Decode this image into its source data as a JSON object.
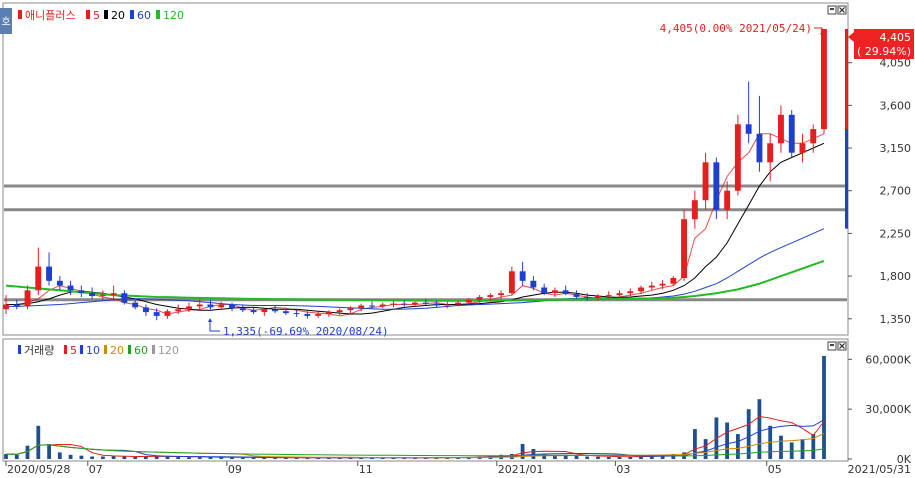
{
  "colors": {
    "up": "#e41f1f",
    "down": "#1f3fcf",
    "ma5": "#000000",
    "ma20": "#000000",
    "ma60": "#1f3fcf",
    "ma120": "#22bb22",
    "hline": "#888888",
    "vol_ma5": "#e41f1f",
    "vol_ma10": "#1f3fcf",
    "vol_ma20": "#d08a00",
    "vol_ma60": "#22a022",
    "vol_ma120": "#999999",
    "current_price_bg": "#ee2222"
  },
  "side_icon_label": "호",
  "window_icons": [
    "restore-icon",
    "close-icon"
  ],
  "price_panel": {
    "legend": {
      "name": "애니플러스",
      "items": [
        {
          "label": "5",
          "color": "#e41f1f"
        },
        {
          "label": "20",
          "color": "#000000"
        },
        {
          "label": "60",
          "color": "#1f3fcf"
        },
        {
          "label": "120",
          "color": "#22bb22"
        }
      ]
    },
    "high_note": "4,405(0.00% 2021/05/24)",
    "low_note": "1,335(-69.69% 2020/08/24)",
    "current_price": "4,405",
    "current_change": "( 29.94%)",
    "y_ticks": [
      "4,050",
      "3,600",
      "3,150",
      "2,700",
      "2,250",
      "1,800",
      "1,350"
    ]
  },
  "volume_panel": {
    "legend": {
      "name": "거래량",
      "items": [
        {
          "label": "5",
          "color": "#e41f1f"
        },
        {
          "label": "10",
          "color": "#1f3fcf"
        },
        {
          "label": "20",
          "color": "#d08a00"
        },
        {
          "label": "60",
          "color": "#22a022"
        },
        {
          "label": "120",
          "color": "#999999"
        }
      ]
    },
    "y_ticks": [
      "60,000K",
      "30,000K",
      "0K"
    ]
  },
  "x_axis": {
    "ticks": [
      "2020/05/28",
      "07",
      "09",
      "11",
      "2021/01",
      "03",
      "05"
    ],
    "end_label": "2021/05/31"
  },
  "chart_data": [
    {
      "type": "candlestick",
      "title": "애니플러스",
      "x_start": "2020/05/28",
      "x_end": "2021/05/31",
      "x_ticks": [
        "2020/05/28",
        "07",
        "09",
        "11",
        "2021/01",
        "03",
        "05"
      ],
      "ylim": [
        1200,
        4500
      ],
      "y_ticks": [
        4050,
        3600,
        3150,
        2700,
        2250,
        1800,
        1350
      ],
      "horizontal_lines": [
        2750,
        2500,
        1550
      ],
      "annotations": [
        {
          "text": "4,405(0.00% 2021/05/24)",
          "value": 4405,
          "date": "2021/05/24"
        },
        {
          "text": "1,335(-69.69% 2020/08/24)",
          "value": 1335,
          "date": "2020/08/24"
        }
      ],
      "current": {
        "price": 4405,
        "change_pct": 29.94
      },
      "series": [
        {
          "name": "5",
          "values": [
            1500,
            1500,
            1520,
            1560,
            1650,
            1700,
            1670,
            1640,
            1610,
            1580,
            1560,
            1520,
            1500,
            1460,
            1440,
            1400,
            1420,
            1440,
            1450,
            1480,
            1500,
            1500,
            1460,
            1440,
            1450,
            1470,
            1460,
            1440,
            1420,
            1410,
            1400,
            1380,
            1400,
            1450,
            1470,
            1480,
            1500,
            1500,
            1500,
            1510,
            1520,
            1500,
            1500,
            1510,
            1530,
            1550,
            1580,
            1600,
            1700,
            1670,
            1620,
            1600,
            1620,
            1600,
            1580,
            1560,
            1560,
            1580,
            1600,
            1620,
            1650,
            1680,
            1700,
            1800,
            2200,
            2300,
            2600,
            2850,
            3000,
            3100,
            3300,
            3300,
            3250,
            3200,
            3200,
            3250,
            3300
          ]
        },
        {
          "name": "20",
          "values": [
            1500,
            1500,
            1510,
            1530,
            1560,
            1600,
            1630,
            1640,
            1630,
            1620,
            1600,
            1580,
            1560,
            1530,
            1500,
            1480,
            1460,
            1450,
            1440,
            1440,
            1450,
            1460,
            1470,
            1470,
            1460,
            1450,
            1450,
            1450,
            1440,
            1430,
            1420,
            1410,
            1400,
            1400,
            1410,
            1430,
            1450,
            1470,
            1480,
            1490,
            1500,
            1500,
            1500,
            1505,
            1510,
            1520,
            1530,
            1550,
            1580,
            1600,
            1620,
            1630,
            1630,
            1620,
            1600,
            1590,
            1580,
            1575,
            1580,
            1590,
            1600,
            1620,
            1650,
            1700,
            1780,
            1900,
            2000,
            2150,
            2350,
            2550,
            2750,
            2900,
            3000,
            3050,
            3100,
            3150,
            3200
          ]
        },
        {
          "name": "60",
          "values": [
            1480,
            1480,
            1485,
            1490,
            1495,
            1500,
            1510,
            1520,
            1530,
            1540,
            1550,
            1555,
            1560,
            1560,
            1555,
            1550,
            1545,
            1540,
            1530,
            1520,
            1510,
            1500,
            1495,
            1490,
            1490,
            1490,
            1490,
            1488,
            1485,
            1480,
            1475,
            1470,
            1465,
            1460,
            1455,
            1450,
            1450,
            1452,
            1455,
            1460,
            1470,
            1480,
            1490,
            1495,
            1500,
            1505,
            1510,
            1515,
            1520,
            1530,
            1540,
            1550,
            1560,
            1565,
            1570,
            1570,
            1568,
            1566,
            1566,
            1568,
            1570,
            1580,
            1590,
            1610,
            1640,
            1680,
            1720,
            1780,
            1850,
            1920,
            1990,
            2050,
            2100,
            2150,
            2200,
            2250,
            2300
          ]
        },
        {
          "name": "120",
          "values": [
            1700,
            1690,
            1680,
            1670,
            1660,
            1650,
            1640,
            1630,
            1620,
            1610,
            1600,
            1595,
            1590,
            1585,
            1580,
            1578,
            1575,
            1572,
            1570,
            1568,
            1566,
            1564,
            1562,
            1560,
            1558,
            1556,
            1555,
            1554,
            1553,
            1552,
            1551,
            1550,
            1549,
            1548,
            1547,
            1546,
            1545,
            1544,
            1543,
            1542,
            1541,
            1540,
            1540,
            1540,
            1540,
            1541,
            1542,
            1543,
            1545,
            1547,
            1549,
            1551,
            1553,
            1555,
            1556,
            1557,
            1558,
            1559,
            1560,
            1562,
            1565,
            1568,
            1572,
            1580,
            1590,
            1605,
            1620,
            1640,
            1660,
            1690,
            1720,
            1760,
            1800,
            1840,
            1880,
            1920,
            1960
          ]
        }
      ],
      "candles": [
        {
          "o": 1450,
          "h": 1600,
          "l": 1400,
          "c": 1500
        },
        {
          "o": 1500,
          "h": 1550,
          "l": 1450,
          "c": 1480
        },
        {
          "o": 1480,
          "h": 1700,
          "l": 1450,
          "c": 1650
        },
        {
          "o": 1650,
          "h": 2100,
          "l": 1600,
          "c": 1900
        },
        {
          "o": 1900,
          "h": 2050,
          "l": 1700,
          "c": 1750
        },
        {
          "o": 1750,
          "h": 1800,
          "l": 1650,
          "c": 1700
        },
        {
          "o": 1700,
          "h": 1750,
          "l": 1600,
          "c": 1650
        },
        {
          "o": 1650,
          "h": 1700,
          "l": 1580,
          "c": 1620
        },
        {
          "o": 1620,
          "h": 1680,
          "l": 1560,
          "c": 1590
        },
        {
          "o": 1590,
          "h": 1650,
          "l": 1550,
          "c": 1600
        },
        {
          "o": 1600,
          "h": 1700,
          "l": 1550,
          "c": 1620
        },
        {
          "o": 1620,
          "h": 1650,
          "l": 1500,
          "c": 1520
        },
        {
          "o": 1520,
          "h": 1560,
          "l": 1450,
          "c": 1470
        },
        {
          "o": 1470,
          "h": 1500,
          "l": 1380,
          "c": 1420
        },
        {
          "o": 1420,
          "h": 1460,
          "l": 1335,
          "c": 1380
        },
        {
          "o": 1380,
          "h": 1450,
          "l": 1350,
          "c": 1430
        },
        {
          "o": 1430,
          "h": 1500,
          "l": 1400,
          "c": 1450
        },
        {
          "o": 1450,
          "h": 1520,
          "l": 1420,
          "c": 1480
        },
        {
          "o": 1480,
          "h": 1560,
          "l": 1440,
          "c": 1500
        },
        {
          "o": 1500,
          "h": 1550,
          "l": 1450,
          "c": 1470
        },
        {
          "o": 1470,
          "h": 1530,
          "l": 1440,
          "c": 1500
        },
        {
          "o": 1500,
          "h": 1520,
          "l": 1430,
          "c": 1460
        },
        {
          "o": 1460,
          "h": 1500,
          "l": 1420,
          "c": 1440
        },
        {
          "o": 1440,
          "h": 1470,
          "l": 1400,
          "c": 1420
        },
        {
          "o": 1420,
          "h": 1460,
          "l": 1380,
          "c": 1450
        },
        {
          "o": 1450,
          "h": 1490,
          "l": 1410,
          "c": 1430
        },
        {
          "o": 1430,
          "h": 1460,
          "l": 1390,
          "c": 1410
        },
        {
          "o": 1410,
          "h": 1450,
          "l": 1370,
          "c": 1400
        },
        {
          "o": 1400,
          "h": 1430,
          "l": 1350,
          "c": 1380
        },
        {
          "o": 1380,
          "h": 1420,
          "l": 1360,
          "c": 1400
        },
        {
          "o": 1400,
          "h": 1440,
          "l": 1370,
          "c": 1420
        },
        {
          "o": 1420,
          "h": 1460,
          "l": 1390,
          "c": 1440
        },
        {
          "o": 1440,
          "h": 1480,
          "l": 1410,
          "c": 1460
        },
        {
          "o": 1460,
          "h": 1510,
          "l": 1430,
          "c": 1490
        },
        {
          "o": 1490,
          "h": 1530,
          "l": 1450,
          "c": 1480
        },
        {
          "o": 1480,
          "h": 1520,
          "l": 1460,
          "c": 1500
        },
        {
          "o": 1500,
          "h": 1540,
          "l": 1470,
          "c": 1510
        },
        {
          "o": 1510,
          "h": 1550,
          "l": 1480,
          "c": 1500
        },
        {
          "o": 1500,
          "h": 1530,
          "l": 1470,
          "c": 1520
        },
        {
          "o": 1520,
          "h": 1560,
          "l": 1490,
          "c": 1510
        },
        {
          "o": 1510,
          "h": 1540,
          "l": 1470,
          "c": 1490
        },
        {
          "o": 1490,
          "h": 1530,
          "l": 1460,
          "c": 1500
        },
        {
          "o": 1500,
          "h": 1540,
          "l": 1480,
          "c": 1520
        },
        {
          "o": 1520,
          "h": 1570,
          "l": 1500,
          "c": 1550
        },
        {
          "o": 1550,
          "h": 1600,
          "l": 1520,
          "c": 1580
        },
        {
          "o": 1580,
          "h": 1620,
          "l": 1540,
          "c": 1600
        },
        {
          "o": 1600,
          "h": 1650,
          "l": 1560,
          "c": 1620
        },
        {
          "o": 1620,
          "h": 1900,
          "l": 1600,
          "c": 1850
        },
        {
          "o": 1850,
          "h": 1950,
          "l": 1700,
          "c": 1750
        },
        {
          "o": 1750,
          "h": 1800,
          "l": 1650,
          "c": 1680
        },
        {
          "o": 1680,
          "h": 1720,
          "l": 1600,
          "c": 1620
        },
        {
          "o": 1620,
          "h": 1680,
          "l": 1580,
          "c": 1650
        },
        {
          "o": 1650,
          "h": 1700,
          "l": 1600,
          "c": 1610
        },
        {
          "o": 1610,
          "h": 1650,
          "l": 1560,
          "c": 1580
        },
        {
          "o": 1580,
          "h": 1620,
          "l": 1540,
          "c": 1570
        },
        {
          "o": 1570,
          "h": 1610,
          "l": 1540,
          "c": 1590
        },
        {
          "o": 1590,
          "h": 1640,
          "l": 1560,
          "c": 1600
        },
        {
          "o": 1600,
          "h": 1650,
          "l": 1570,
          "c": 1620
        },
        {
          "o": 1620,
          "h": 1670,
          "l": 1590,
          "c": 1640
        },
        {
          "o": 1640,
          "h": 1700,
          "l": 1610,
          "c": 1680
        },
        {
          "o": 1680,
          "h": 1740,
          "l": 1650,
          "c": 1700
        },
        {
          "o": 1700,
          "h": 1760,
          "l": 1660,
          "c": 1720
        },
        {
          "o": 1720,
          "h": 1800,
          "l": 1700,
          "c": 1780
        },
        {
          "o": 1780,
          "h": 2500,
          "l": 1750,
          "c": 2400
        },
        {
          "o": 2400,
          "h": 2700,
          "l": 2300,
          "c": 2600
        },
        {
          "o": 2600,
          "h": 3100,
          "l": 2500,
          "c": 3000
        },
        {
          "o": 3000,
          "h": 3050,
          "l": 2400,
          "c": 2500
        },
        {
          "o": 2500,
          "h": 2800,
          "l": 2400,
          "c": 2700
        },
        {
          "o": 2700,
          "h": 3500,
          "l": 2650,
          "c": 3400
        },
        {
          "o": 3400,
          "h": 3850,
          "l": 3200,
          "c": 3300
        },
        {
          "o": 3300,
          "h": 3700,
          "l": 2900,
          "c": 3000
        },
        {
          "o": 3000,
          "h": 3300,
          "l": 2800,
          "c": 3200
        },
        {
          "o": 3200,
          "h": 3600,
          "l": 3100,
          "c": 3500
        },
        {
          "o": 3500,
          "h": 3550,
          "l": 3050,
          "c": 3100
        },
        {
          "o": 3100,
          "h": 3300,
          "l": 3000,
          "c": 3200
        },
        {
          "o": 3200,
          "h": 3400,
          "l": 3100,
          "c": 3350
        },
        {
          "o": 3350,
          "h": 4405,
          "l": 3300,
          "c": 4405
        }
      ]
    },
    {
      "type": "bar",
      "title": "거래량",
      "ylim": [
        0,
        62000
      ],
      "y_ticks": [
        60000,
        30000,
        0
      ],
      "values": [
        3000,
        2500,
        8000,
        20000,
        9000,
        4000,
        2500,
        2000,
        1500,
        1500,
        1800,
        1500,
        1200,
        1500,
        2000,
        1500,
        1200,
        1000,
        1000,
        1200,
        1000,
        900,
        800,
        800,
        900,
        800,
        700,
        700,
        800,
        700,
        700,
        800,
        900,
        900,
        800,
        800,
        700,
        800,
        800,
        900,
        800,
        900,
        1000,
        1200,
        1500,
        2000,
        2500,
        3000,
        9000,
        6000,
        3000,
        2000,
        2500,
        1800,
        1500,
        1300,
        1200,
        1300,
        1500,
        1800,
        2000,
        2500,
        3000,
        4000,
        18000,
        12000,
        25000,
        22000,
        15000,
        30000,
        36000,
        20000,
        14000,
        10000,
        12000,
        15000,
        62000
      ]
    }
  ]
}
